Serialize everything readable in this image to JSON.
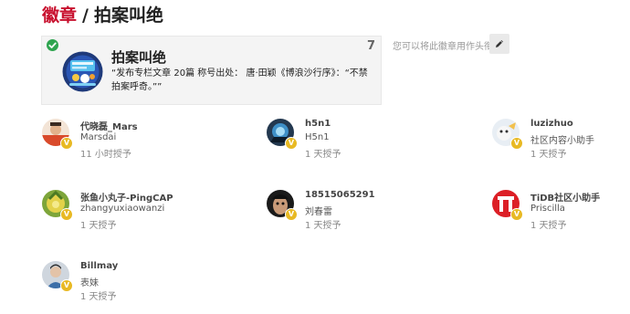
{
  "header": {
    "breadcrumb_link": "徽章",
    "separator": "/",
    "title": "拍案叫绝"
  },
  "badge": {
    "name": "拍案叫绝",
    "count": "7",
    "description": "“发布专栏文章 20篇 称号出处： 唐·田颖《博浪沙行序》：“不禁拍案呼奇。””",
    "icon": "badge-emblem",
    "status_icon": "check-circle-icon"
  },
  "sidebar": {
    "avatar_hint": "您可以将此徽章用作头衔",
    "edit_icon": "pencil-icon"
  },
  "users": [
    {
      "username": "代晓磊_Mars",
      "full_name": "Marsdai",
      "granted": "11 小时授予",
      "badge_letter": "V"
    },
    {
      "username": "h5n1",
      "full_name": "H5n1",
      "granted": "1 天授予",
      "badge_letter": "V"
    },
    {
      "username": "luzizhuo",
      "full_name": "社区内容小助手",
      "granted": "1 天授予",
      "badge_letter": "V"
    },
    {
      "username": "张鱼小丸子-PingCAP",
      "full_name": "zhangyuxiaowanzi",
      "granted": "1 天授予",
      "badge_letter": "V"
    },
    {
      "username": "18515065291",
      "full_name": "刘春雷",
      "granted": "1 天授予",
      "badge_letter": "V"
    },
    {
      "username": "TiDB社区小助手",
      "full_name": "Priscilla",
      "granted": "1 天授予",
      "badge_letter": "V"
    },
    {
      "username": "Billmay",
      "full_name": "表妹",
      "granted": "1 天授予",
      "badge_letter": "V"
    }
  ],
  "colors": {
    "accent": "#c8102e",
    "check": "#2ea44f",
    "mini_badge": "#e8b923"
  }
}
